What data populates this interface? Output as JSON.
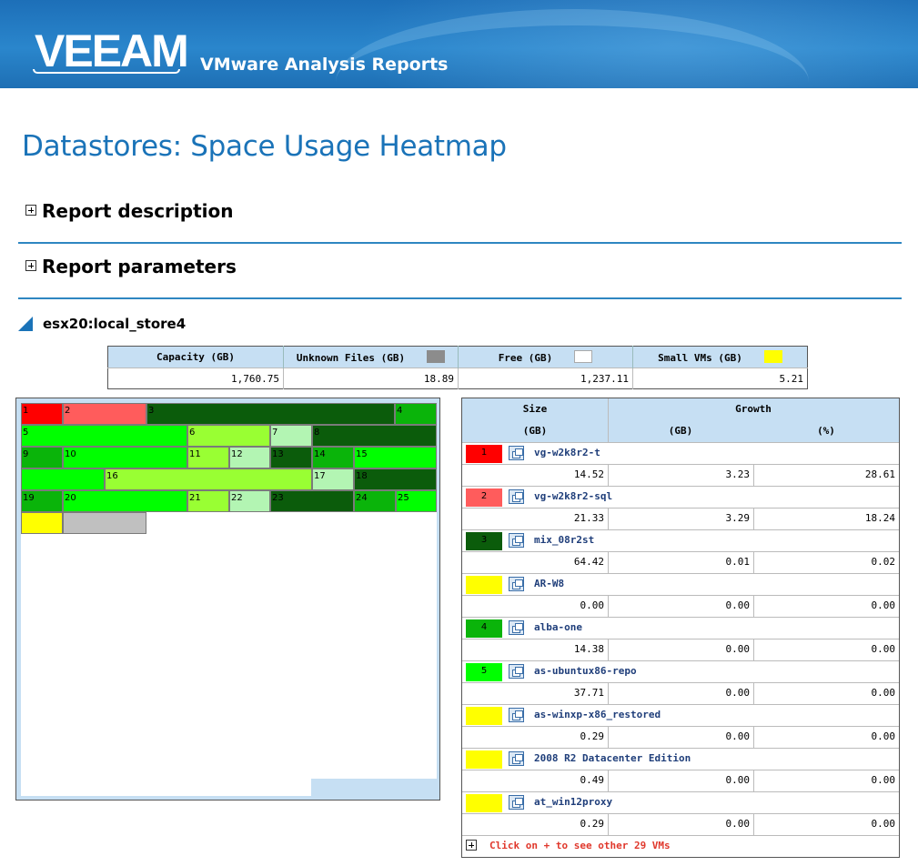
{
  "header": {
    "logo_text": "VEEAM",
    "app_title": "VMware Analysis Reports"
  },
  "page_title": "Datastores: Space Usage Heatmap",
  "sections": {
    "description": "Report description",
    "parameters": "Report parameters"
  },
  "datastore": {
    "name": "esx20:local_store4",
    "summary": {
      "headers": [
        "Capacity (GB)",
        "Unknown Files (GB)",
        "Free (GB)",
        "Small VMs (GB)"
      ],
      "values": [
        "1,760.75",
        "18.89",
        "1,237.11",
        "5.21"
      ],
      "swatch_colors": [
        "",
        "#8c8c8c",
        "#ffffff",
        "#ffff00"
      ]
    }
  },
  "heatmap": {
    "cells": [
      {
        "label": "1",
        "color": "#ff0000"
      },
      {
        "label": "2",
        "color": "#ff5c5c"
      },
      {
        "label": "3",
        "color": "#0b5c0b"
      },
      {
        "label": "4",
        "color": "#0ab40a"
      },
      {
        "label": "5",
        "color": "#00ff00"
      },
      {
        "label": "6",
        "color": "#99ff33"
      },
      {
        "label": "7",
        "color": "#b3f5b3"
      },
      {
        "label": "8",
        "color": "#0b5c0b"
      },
      {
        "label": "9",
        "color": "#0ab40a"
      },
      {
        "label": "10",
        "color": "#00ff00"
      },
      {
        "label": "11",
        "color": "#99ff33"
      },
      {
        "label": "12",
        "color": "#b3f5b3"
      },
      {
        "label": "13",
        "color": "#0b5c0b"
      },
      {
        "label": "14",
        "color": "#0ab40a"
      },
      {
        "label": "15",
        "color": "#00ff00"
      },
      {
        "label": "",
        "color": "#00ff00"
      },
      {
        "label": "16",
        "color": "#99ff33"
      },
      {
        "label": "17",
        "color": "#b3f5b3"
      },
      {
        "label": "18",
        "color": "#0b5c0b"
      },
      {
        "label": "19",
        "color": "#0ab40a"
      },
      {
        "label": "20",
        "color": "#00ff00"
      },
      {
        "label": "21",
        "color": "#99ff33"
      },
      {
        "label": "22",
        "color": "#b3f5b3"
      },
      {
        "label": "23",
        "color": "#0b5c0b"
      },
      {
        "label": "24",
        "color": "#0ab40a"
      },
      {
        "label": "25",
        "color": "#00ff00"
      },
      {
        "label": "",
        "color": "#ffff00"
      },
      {
        "label": "",
        "color": "#c0c0c0"
      }
    ]
  },
  "vm_table": {
    "headers": {
      "size": "Size",
      "size_unit": "(GB)",
      "growth": "Growth",
      "growth_gb": "(GB)",
      "growth_pct": "(%)"
    },
    "rows": [
      {
        "rank": "1",
        "color": "#ff0000",
        "name": "vg-w2k8r2-t",
        "size": "14.52",
        "growth_gb": "3.23",
        "growth_pct": "28.61"
      },
      {
        "rank": "2",
        "color": "#ff5c5c",
        "name": "vg-w2k8r2-sql",
        "size": "21.33",
        "growth_gb": "3.29",
        "growth_pct": "18.24"
      },
      {
        "rank": "3",
        "color": "#0b5c0b",
        "name": "mix_08r2st",
        "size": "64.42",
        "growth_gb": "0.01",
        "growth_pct": "0.02"
      },
      {
        "rank": "",
        "color": "#ffff00",
        "name": "AR-W8",
        "size": "0.00",
        "growth_gb": "0.00",
        "growth_pct": "0.00"
      },
      {
        "rank": "4",
        "color": "#0ab40a",
        "name": "alba-one",
        "size": "14.38",
        "growth_gb": "0.00",
        "growth_pct": "0.00"
      },
      {
        "rank": "5",
        "color": "#00ff00",
        "name": "as-ubuntux86-repo",
        "size": "37.71",
        "growth_gb": "0.00",
        "growth_pct": "0.00"
      },
      {
        "rank": "",
        "color": "#ffff00",
        "name": "as-winxp-x86_restored",
        "size": "0.29",
        "growth_gb": "0.00",
        "growth_pct": "0.00"
      },
      {
        "rank": "",
        "color": "#ffff00",
        "name": "2008 R2 Datacenter Edition",
        "size": "0.49",
        "growth_gb": "0.00",
        "growth_pct": "0.00"
      },
      {
        "rank": "",
        "color": "#ffff00",
        "name": "at_win12proxy",
        "size": "0.29",
        "growth_gb": "0.00",
        "growth_pct": "0.00"
      }
    ],
    "more_link": "Click on + to see other 29 VMs"
  }
}
